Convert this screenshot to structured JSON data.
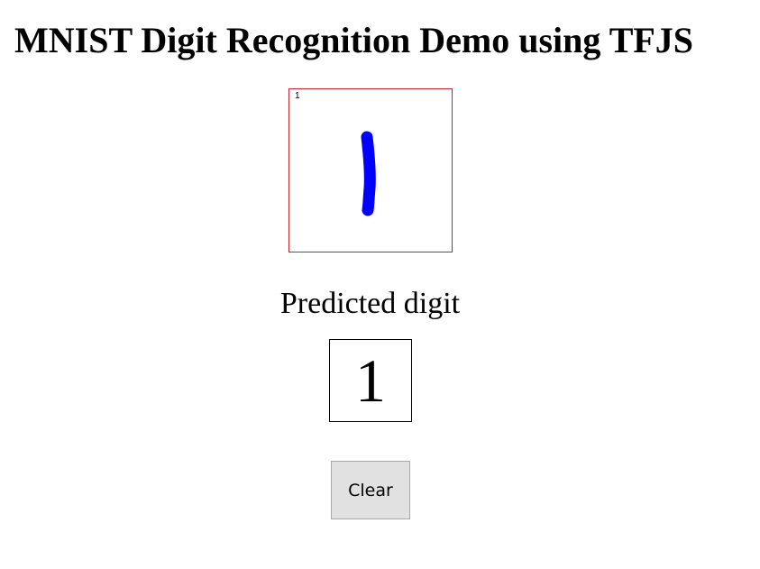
{
  "page": {
    "title": "MNIST Digit Recognition Demo using TFJS"
  },
  "canvas": {
    "corner_label": "1",
    "stroke_color": "#0000ff",
    "border_color": "#c0262d"
  },
  "prediction": {
    "label": "Predicted digit",
    "value": "1"
  },
  "controls": {
    "clear_label": "Clear"
  }
}
